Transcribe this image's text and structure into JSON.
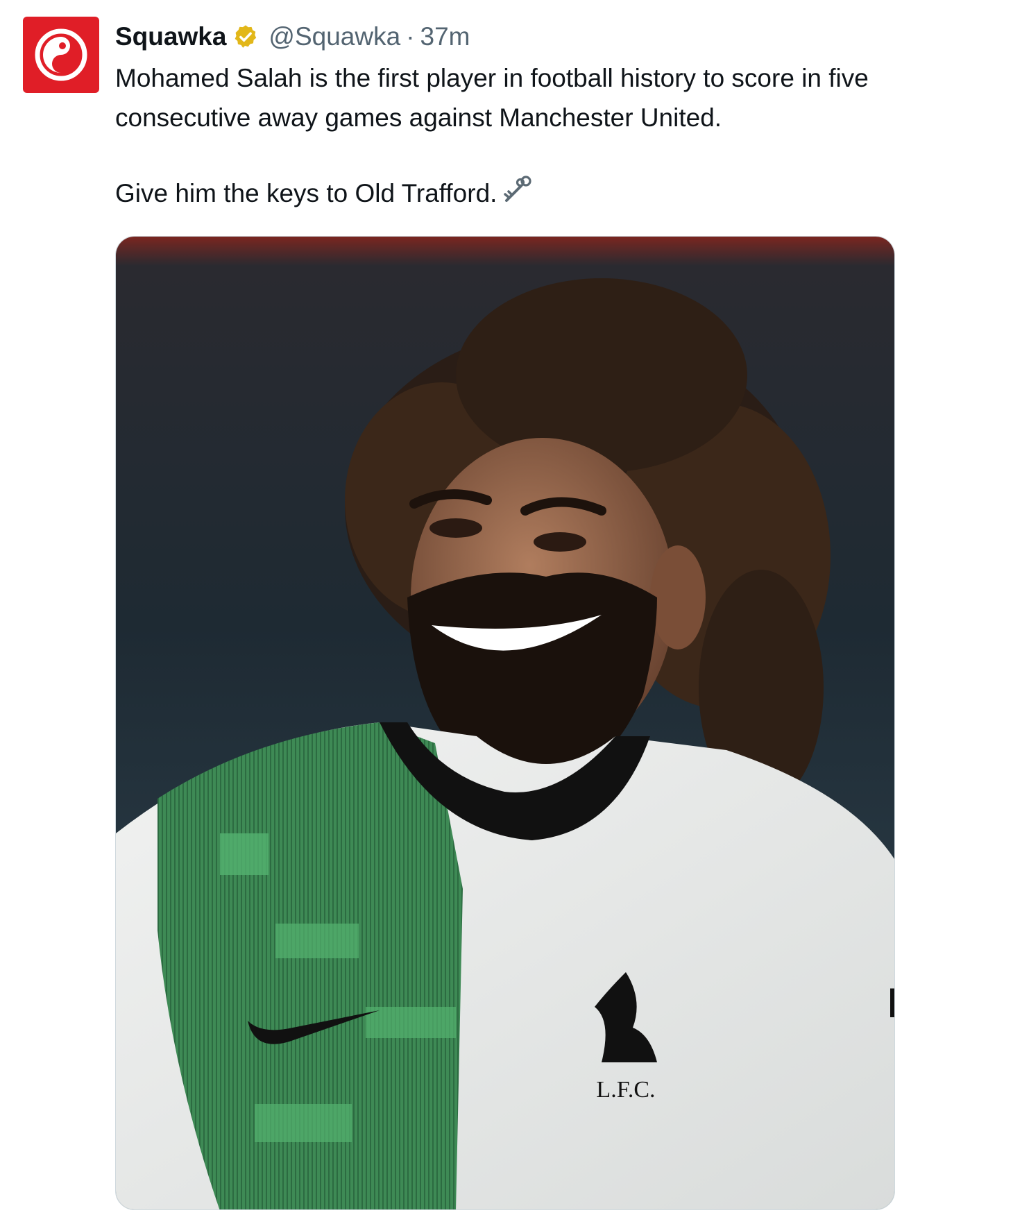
{
  "author": {
    "display_name": "Squawka",
    "handle": "@Squawka",
    "separator": "·",
    "timestamp": "37m",
    "verified": true,
    "verified_color": "#e2b719",
    "avatar_color": "#e01e27",
    "avatar_icon": "squawka-logo-icon"
  },
  "tweet": {
    "line1": "Mohamed Salah is the first player in football history to score in five consecutive away games against Manchester United.",
    "line2": "Give him the keys to Old Trafford.",
    "emoji": "old-key-emoji"
  },
  "media": {
    "description_icon": "player-photo",
    "crest_text": "L.F.C.",
    "sponsor_letter": "E"
  }
}
